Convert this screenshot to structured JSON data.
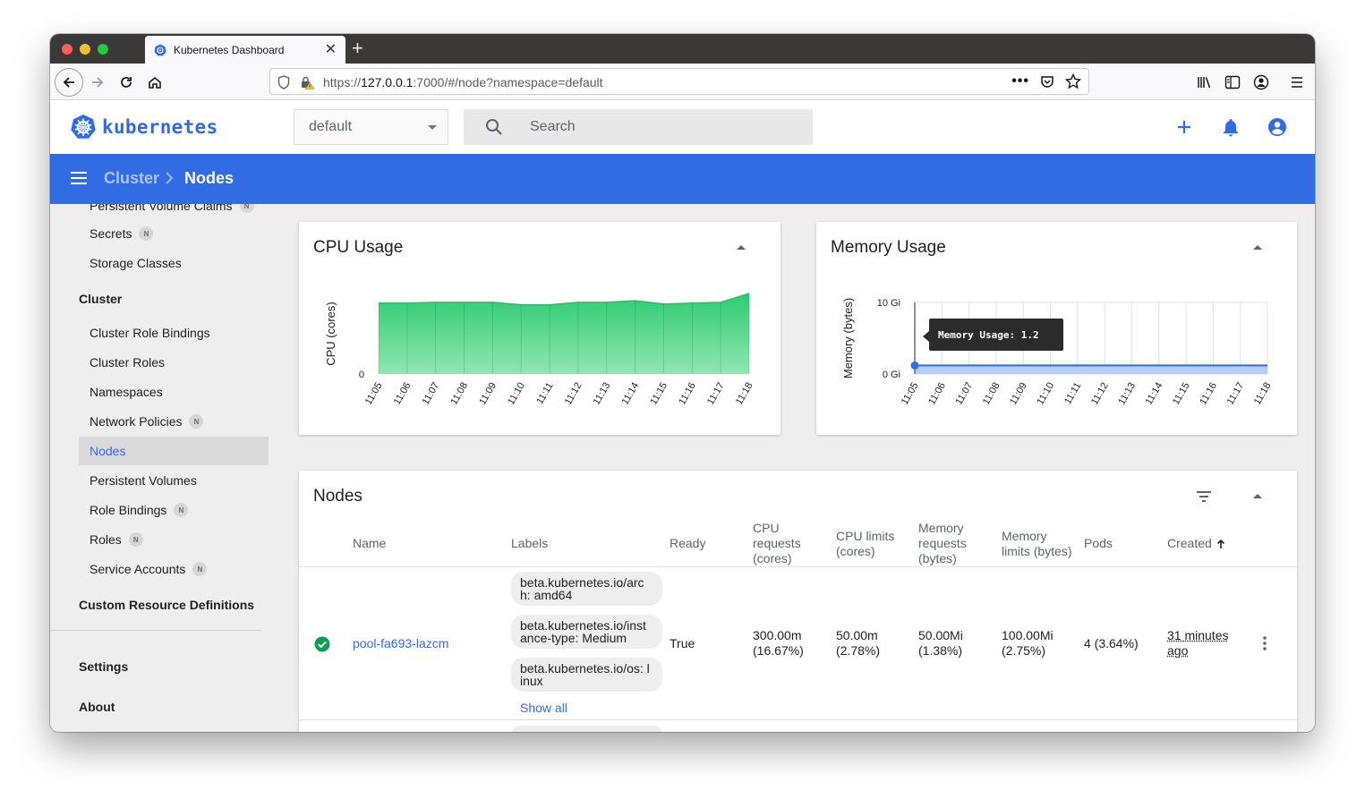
{
  "browser": {
    "tab_title": "Kubernetes Dashboard",
    "url_prefix": "https://",
    "url_host": "127.0.0.1",
    "url_rest": ":7000/#/node?namespace=default"
  },
  "header": {
    "logo_text": "kubernetes",
    "namespace": "default",
    "search_placeholder": "Search"
  },
  "toolbar": {
    "parent": "Cluster",
    "current": "Nodes"
  },
  "sidebar": {
    "partial_item": "Persistent Volume Claims",
    "items_top": [
      {
        "label": "Secrets",
        "badge": "N"
      },
      {
        "label": "Storage Classes",
        "badge": ""
      }
    ],
    "cluster_section": "Cluster",
    "cluster_items": [
      {
        "label": "Cluster Role Bindings",
        "badge": ""
      },
      {
        "label": "Cluster Roles",
        "badge": ""
      },
      {
        "label": "Namespaces",
        "badge": ""
      },
      {
        "label": "Network Policies",
        "badge": "N"
      },
      {
        "label": "Nodes",
        "badge": ""
      },
      {
        "label": "Persistent Volumes",
        "badge": ""
      },
      {
        "label": "Role Bindings",
        "badge": "N"
      },
      {
        "label": "Roles",
        "badge": "N"
      },
      {
        "label": "Service Accounts",
        "badge": "N"
      }
    ],
    "crd_section": "Custom Resource Definitions",
    "settings": "Settings",
    "about": "About"
  },
  "cpu_card": {
    "title": "CPU Usage"
  },
  "memory_card": {
    "title": "Memory Usage",
    "tooltip": "Memory Usage: 1.2"
  },
  "chart_data": [
    {
      "type": "area",
      "title": "CPU Usage",
      "ylabel": "CPU (cores)",
      "x": [
        "11:05",
        "11:06",
        "11:07",
        "11:08",
        "11:09",
        "11:10",
        "11:11",
        "11:12",
        "11:13",
        "11:14",
        "11:15",
        "11:16",
        "11:17",
        "11:18"
      ],
      "y_tick_labels": [
        "0"
      ],
      "series": [
        {
          "values": [
            0.88,
            0.88,
            0.89,
            0.89,
            0.89,
            0.86,
            0.86,
            0.89,
            0.89,
            0.91,
            0.87,
            0.88,
            0.89,
            1.0
          ]
        }
      ],
      "color": "#2ecc71"
    },
    {
      "type": "area",
      "title": "Memory Usage",
      "ylabel": "Memory (bytes)",
      "x": [
        "11:05",
        "11:06",
        "11:07",
        "11:08",
        "11:09",
        "11:10",
        "11:11",
        "11:12",
        "11:13",
        "11:14",
        "11:15",
        "11:16",
        "11:17",
        "11:18"
      ],
      "y_tick_labels": [
        "0 Gi",
        "10 Gi"
      ],
      "ylim": [
        0,
        10
      ],
      "series": [
        {
          "values": [
            1.2,
            1.2,
            1.2,
            1.2,
            1.2,
            1.2,
            1.2,
            1.2,
            1.2,
            1.2,
            1.2,
            1.2,
            1.2,
            1.2
          ]
        }
      ],
      "color": "#326ce5"
    }
  ],
  "nodes_table": {
    "title": "Nodes",
    "columns": {
      "name": "Name",
      "labels": "Labels",
      "ready": "Ready",
      "cpu_req": [
        "CPU",
        "requests",
        "(cores)"
      ],
      "cpu_lim": [
        "CPU limits",
        "(cores)"
      ],
      "mem_req": [
        "Memory",
        "requests",
        "(bytes)"
      ],
      "mem_lim": [
        "Memory",
        "limits (bytes)"
      ],
      "pods": "Pods",
      "created": "Created"
    },
    "rows": [
      {
        "name": "pool-fa693-lazcm",
        "labels": [
          [
            "beta.kubernetes.io/arc",
            "h: amd64"
          ],
          [
            "beta.kubernetes.io/inst",
            "ance-type: Medium"
          ],
          [
            "beta.kubernetes.io/os: l",
            "inux"
          ]
        ],
        "show_all": "Show all",
        "ready": "True",
        "cpu_req": [
          "300.00m",
          "(16.67%)"
        ],
        "cpu_lim": [
          "50.00m",
          "(2.78%)"
        ],
        "mem_req": [
          "50.00Mi",
          "(1.38%)"
        ],
        "mem_lim": [
          "100.00Mi",
          "(2.75%)"
        ],
        "pods": "4 (3.64%)",
        "created": [
          "31 minutes",
          "ago"
        ]
      }
    ]
  }
}
